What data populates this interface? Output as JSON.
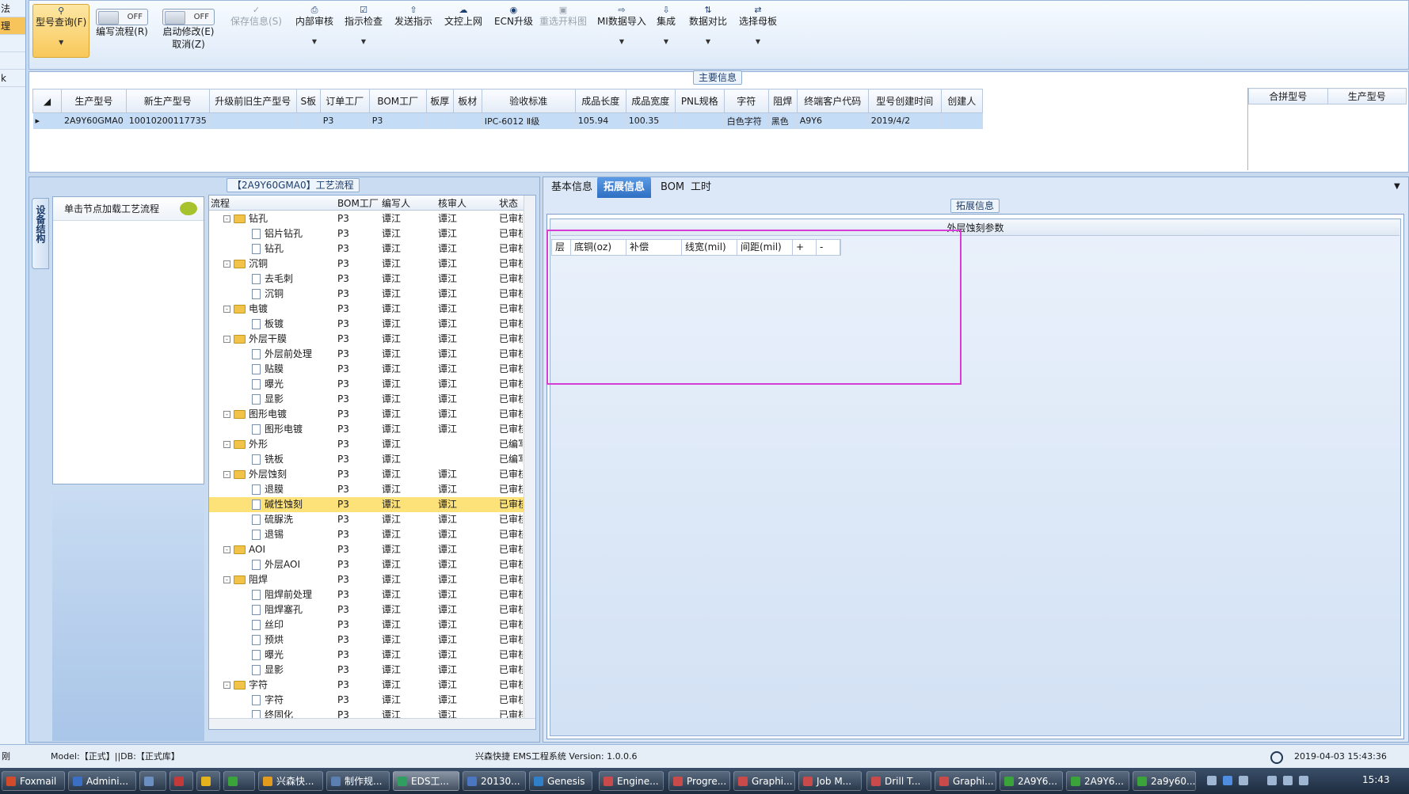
{
  "left_strip": {
    "items": [
      "法",
      "理",
      "",
      "",
      "k"
    ]
  },
  "ribbon": {
    "model_query": {
      "label": "型号查询(F)",
      "icon": "search-icon"
    },
    "write_flow": {
      "label": "编写流程(R)",
      "toggle": "OFF"
    },
    "start_modify": {
      "label": "启动修改(E)",
      "label2": "取消(Z)",
      "toggle": "OFF"
    },
    "save_info": {
      "label": "保存信息(S)",
      "icon": "check-icon"
    },
    "internal_review": {
      "label": "内部审核",
      "icon": "printer-icon"
    },
    "instruction_check": {
      "label": "指示检查",
      "icon": "checkbox-icon"
    },
    "send_instruction": {
      "label": "发送指示",
      "icon": "upload-icon"
    },
    "doc_upload": {
      "label": "文控上网",
      "icon": "cloud-upload-icon"
    },
    "ecn_upgrade": {
      "label": "ECN升级",
      "icon": "binoculars-icon"
    },
    "reselect_chart": {
      "label": "重选开料图",
      "icon": "image-icon"
    },
    "mi_import": {
      "label": "MI数据导入",
      "icon": "import-icon"
    },
    "integrate": {
      "label": "集成",
      "icon": "download-icon"
    },
    "data_compare": {
      "label": "数据对比",
      "icon": "compare-icon"
    },
    "select_master": {
      "label": "选择母板",
      "icon": "shuffle-icon"
    }
  },
  "main_info": {
    "title": "主要信息",
    "columns": [
      "生产型号",
      "新生产型号",
      "升级前旧生产型号",
      "S板",
      "订单工厂",
      "BOM工厂",
      "板厚",
      "板材",
      "验收标准",
      "成品长度",
      "成品宽度",
      "PNL规格",
      "字符",
      "阻焊",
      "终端客户代码",
      "型号创建时间",
      "创建人"
    ],
    "row": [
      "2A9Y60GMA0",
      "10010200117735",
      "",
      "",
      "P3",
      "P3",
      "",
      "",
      "IPC-6012 Ⅱ级",
      "105.94",
      "100.35",
      "",
      "白色字符",
      "黑色",
      "A9Y6",
      "2019/4/2",
      ""
    ],
    "side_columns": [
      "合拼型号",
      "生产型号"
    ]
  },
  "process": {
    "title": "【2A9Y60GMA0】工艺流程",
    "vertical_tab": "设备结构",
    "load_hint": "单击节点加载工艺流程",
    "headers": [
      "流程",
      "BOM工厂",
      "编写人",
      "核审人",
      "状态"
    ],
    "rows": [
      {
        "name": "钻孔",
        "folder": true,
        "bom": "P3",
        "writer": "谭江",
        "reviewer": "谭江",
        "status": "已审核"
      },
      {
        "name": "铝片钻孔",
        "folder": false,
        "bom": "P3",
        "writer": "谭江",
        "reviewer": "谭江",
        "status": "已审核"
      },
      {
        "name": "钻孔",
        "folder": false,
        "bom": "P3",
        "writer": "谭江",
        "reviewer": "谭江",
        "status": "已审核"
      },
      {
        "name": "沉铜",
        "folder": true,
        "bom": "P3",
        "writer": "谭江",
        "reviewer": "谭江",
        "status": "已审核"
      },
      {
        "name": "去毛刺",
        "folder": false,
        "bom": "P3",
        "writer": "谭江",
        "reviewer": "谭江",
        "status": "已审核"
      },
      {
        "name": "沉铜",
        "folder": false,
        "bom": "P3",
        "writer": "谭江",
        "reviewer": "谭江",
        "status": "已审核"
      },
      {
        "name": "电镀",
        "folder": true,
        "bom": "P3",
        "writer": "谭江",
        "reviewer": "谭江",
        "status": "已审核"
      },
      {
        "name": "板镀",
        "folder": false,
        "bom": "P3",
        "writer": "谭江",
        "reviewer": "谭江",
        "status": "已审核"
      },
      {
        "name": "外层干膜",
        "folder": true,
        "bom": "P3",
        "writer": "谭江",
        "reviewer": "谭江",
        "status": "已审核"
      },
      {
        "name": "外层前处理",
        "folder": false,
        "bom": "P3",
        "writer": "谭江",
        "reviewer": "谭江",
        "status": "已审核"
      },
      {
        "name": "贴膜",
        "folder": false,
        "bom": "P3",
        "writer": "谭江",
        "reviewer": "谭江",
        "status": "已审核"
      },
      {
        "name": "曝光",
        "folder": false,
        "bom": "P3",
        "writer": "谭江",
        "reviewer": "谭江",
        "status": "已审核"
      },
      {
        "name": "显影",
        "folder": false,
        "bom": "P3",
        "writer": "谭江",
        "reviewer": "谭江",
        "status": "已审核"
      },
      {
        "name": "图形电镀",
        "folder": true,
        "bom": "P3",
        "writer": "谭江",
        "reviewer": "谭江",
        "status": "已审核"
      },
      {
        "name": "图形电镀",
        "folder": false,
        "bom": "P3",
        "writer": "谭江",
        "reviewer": "谭江",
        "status": "已审核"
      },
      {
        "name": "外形",
        "folder": true,
        "bom": "P3",
        "writer": "谭江",
        "reviewer": "",
        "status": "已编写"
      },
      {
        "name": "铣板",
        "folder": false,
        "bom": "P3",
        "writer": "谭江",
        "reviewer": "",
        "status": "已编写"
      },
      {
        "name": "外层蚀刻",
        "folder": true,
        "bom": "P3",
        "writer": "谭江",
        "reviewer": "谭江",
        "status": "已审核"
      },
      {
        "name": "退膜",
        "folder": false,
        "bom": "P3",
        "writer": "谭江",
        "reviewer": "谭江",
        "status": "已审核"
      },
      {
        "name": "碱性蚀刻",
        "folder": false,
        "bom": "P3",
        "writer": "谭江",
        "reviewer": "谭江",
        "status": "已审核",
        "selected": true
      },
      {
        "name": "硫脲洗",
        "folder": false,
        "bom": "P3",
        "writer": "谭江",
        "reviewer": "谭江",
        "status": "已审核"
      },
      {
        "name": "退锡",
        "folder": false,
        "bom": "P3",
        "writer": "谭江",
        "reviewer": "谭江",
        "status": "已审核"
      },
      {
        "name": "AOI",
        "folder": true,
        "bom": "P3",
        "writer": "谭江",
        "reviewer": "谭江",
        "status": "已审核"
      },
      {
        "name": "外层AOI",
        "folder": false,
        "bom": "P3",
        "writer": "谭江",
        "reviewer": "谭江",
        "status": "已审核"
      },
      {
        "name": "阻焊",
        "folder": true,
        "bom": "P3",
        "writer": "谭江",
        "reviewer": "谭江",
        "status": "已审核"
      },
      {
        "name": "阻焊前处理",
        "folder": false,
        "bom": "P3",
        "writer": "谭江",
        "reviewer": "谭江",
        "status": "已审核"
      },
      {
        "name": "阻焊塞孔",
        "folder": false,
        "bom": "P3",
        "writer": "谭江",
        "reviewer": "谭江",
        "status": "已审核"
      },
      {
        "name": "丝印",
        "folder": false,
        "bom": "P3",
        "writer": "谭江",
        "reviewer": "谭江",
        "status": "已审核"
      },
      {
        "name": "预烘",
        "folder": false,
        "bom": "P3",
        "writer": "谭江",
        "reviewer": "谭江",
        "status": "已审核"
      },
      {
        "name": "曝光",
        "folder": false,
        "bom": "P3",
        "writer": "谭江",
        "reviewer": "谭江",
        "status": "已审核"
      },
      {
        "name": "显影",
        "folder": false,
        "bom": "P3",
        "writer": "谭江",
        "reviewer": "谭江",
        "status": "已审核"
      },
      {
        "name": "字符",
        "folder": true,
        "bom": "P3",
        "writer": "谭江",
        "reviewer": "谭江",
        "status": "已审核"
      },
      {
        "name": "字符",
        "folder": false,
        "bom": "P3",
        "writer": "谭江",
        "reviewer": "谭江",
        "status": "已审核"
      },
      {
        "name": "终固化",
        "folder": false,
        "bom": "P3",
        "writer": "谭江",
        "reviewer": "谭江",
        "status": "已审核"
      }
    ]
  },
  "right": {
    "tabs": [
      "基本信息",
      "拓展信息",
      "BOM",
      "工时"
    ],
    "active_tab": "拓展信息",
    "section_title": "拓展信息",
    "param_title": "外层蚀刻参数",
    "param_columns": [
      "层",
      "底铜(oz)",
      "补偿",
      "线宽(mil)",
      "间距(mil)",
      "+",
      "-"
    ]
  },
  "status": {
    "left": "刚",
    "model_db": "Model:【正式】||DB:【正式库】",
    "system": "兴森快捷 EMS工程系统 Version: 1.0.0.6",
    "datetime": "2019-04-03 15:43:36"
  },
  "taskbar": {
    "items": [
      "Foxmail",
      "Admini...",
      "",
      "",
      "",
      "",
      "兴森快...",
      "制作规...",
      "EDS工...",
      "20130...",
      "Genesis",
      "Engine...",
      "Progre...",
      "Graphi...",
      "Job M...",
      "Drill T...",
      "Graphi...",
      "2A9Y6...",
      "2A9Y6...",
      "2a9y60..."
    ],
    "clock": "15:43"
  },
  "colors": {
    "accent": "#2f6fc2",
    "highlight": "#fde27a",
    "annotation": "#d63cd6"
  }
}
